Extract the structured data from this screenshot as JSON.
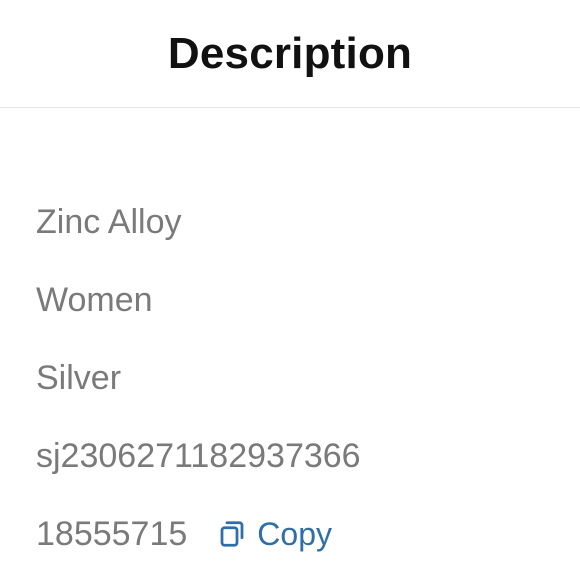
{
  "header": {
    "title": "Description"
  },
  "details": {
    "material": "Zinc Alloy",
    "gender": "Women",
    "color": "Silver",
    "sku": "sj2306271182937366",
    "order_number": "18555715",
    "copy_label": "Copy"
  },
  "colors": {
    "text": "#7a7a7a",
    "title": "#111111",
    "link": "#2f6ea6",
    "divider": "#e6e6e6"
  },
  "icons": {
    "copy": "copy-icon"
  }
}
